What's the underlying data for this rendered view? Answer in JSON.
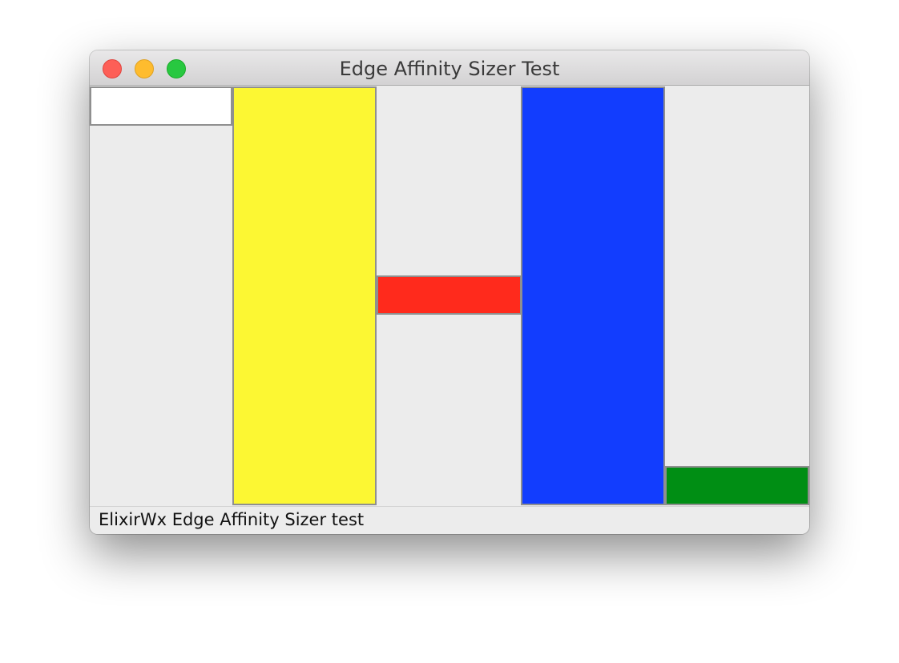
{
  "window": {
    "title": "Edge Affinity Sizer Test"
  },
  "panels": [
    {
      "name": "white-panel",
      "color": "#ffffff"
    },
    {
      "name": "yellow-panel",
      "color": "#fcf733"
    },
    {
      "name": "red-panel",
      "color": "#ff2a1c"
    },
    {
      "name": "blue-panel",
      "color": "#123dfe"
    },
    {
      "name": "green-panel",
      "color": "#008e14"
    }
  ],
  "statusbar": {
    "text": "ElixirWx Edge Affinity Sizer test"
  }
}
